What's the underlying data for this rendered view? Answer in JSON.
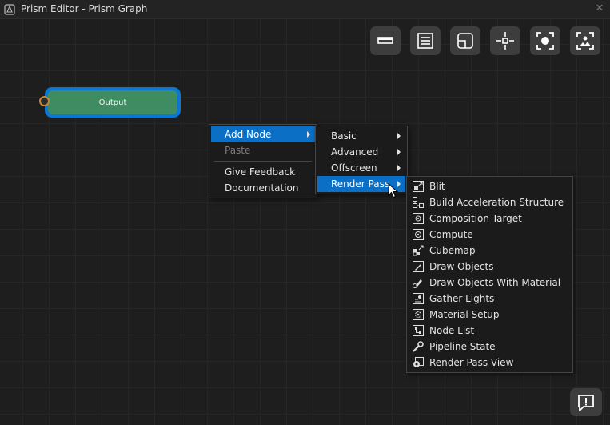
{
  "window": {
    "title": "Prism Editor - Prism Graph",
    "close_glyph": "✕"
  },
  "toolbar": {
    "buttons": [
      {
        "name": "toolbar-panel-button",
        "icon": "panel-bar-icon"
      },
      {
        "name": "toolbar-list-button",
        "icon": "list-icon"
      },
      {
        "name": "toolbar-minimize-button",
        "icon": "resize-window-icon"
      },
      {
        "name": "toolbar-center-button",
        "icon": "crosshair-icon"
      },
      {
        "name": "toolbar-frame-selection-button",
        "icon": "focus-icon"
      },
      {
        "name": "toolbar-screenshot-button",
        "icon": "image-capture-icon"
      }
    ]
  },
  "node": {
    "label": "Output",
    "border_color": "#0a76d6",
    "fill_color": "#3f8c62",
    "port_color": "#c08a38"
  },
  "context_menu": {
    "items": [
      {
        "label": "Add Node",
        "highlighted": true,
        "submenu": true
      },
      {
        "label": "Paste",
        "disabled": true
      },
      {
        "separator": true
      },
      {
        "label": "Give Feedback"
      },
      {
        "label": "Documentation"
      }
    ]
  },
  "add_node_menu": {
    "items": [
      {
        "label": "Basic"
      },
      {
        "label": "Advanced"
      },
      {
        "label": "Offscreen"
      },
      {
        "label": "Render Pass",
        "highlighted": true
      }
    ]
  },
  "render_pass_menu": {
    "items": [
      {
        "label": "Blit",
        "icon": "blit-icon"
      },
      {
        "label": "Build Acceleration Structure",
        "icon": "acceleration-structure-icon"
      },
      {
        "label": "Composition Target",
        "icon": "composition-target-icon"
      },
      {
        "label": "Compute",
        "icon": "compute-icon"
      },
      {
        "label": "Cubemap",
        "icon": "cubemap-icon"
      },
      {
        "label": "Draw Objects",
        "icon": "draw-objects-icon"
      },
      {
        "label": "Draw Objects With Material",
        "icon": "draw-material-icon"
      },
      {
        "label": "Gather Lights",
        "icon": "gather-lights-icon"
      },
      {
        "label": "Material Setup",
        "icon": "material-setup-icon"
      },
      {
        "label": "Node List",
        "icon": "node-list-icon"
      },
      {
        "label": "Pipeline State",
        "icon": "wrench-icon"
      },
      {
        "label": "Render Pass View",
        "icon": "render-pass-view-icon"
      }
    ]
  },
  "feedback_button": {
    "icon": "feedback-speech-icon"
  },
  "colors": {
    "accent": "#0b6fc6",
    "background": "#1e1e1e",
    "button_bg": "#3d3d3d"
  }
}
